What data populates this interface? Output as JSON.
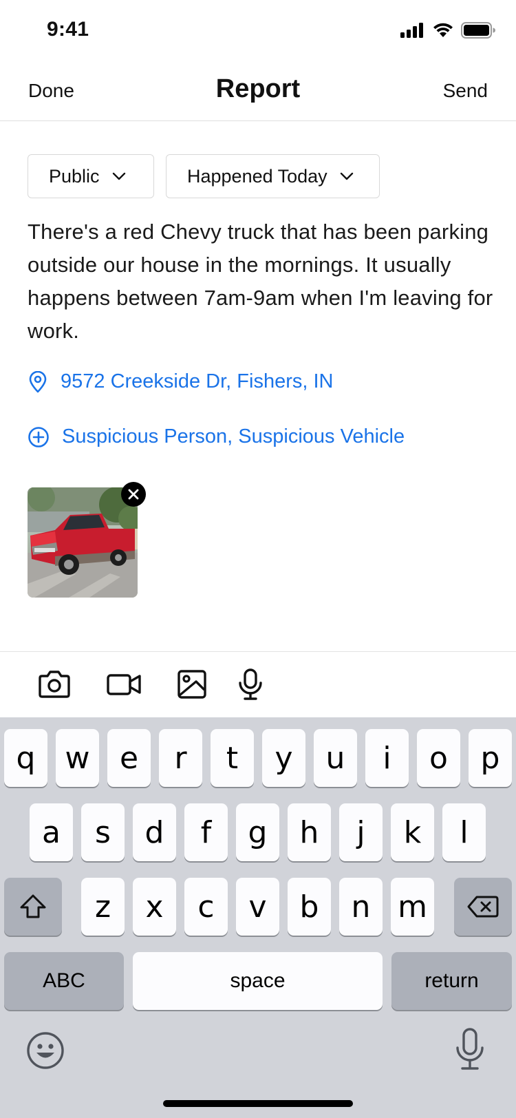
{
  "status_bar": {
    "time": "9:41"
  },
  "nav": {
    "left": "Done",
    "title": "Report",
    "right": "Send"
  },
  "filters": {
    "visibility": "Public",
    "timeframe": "Happened Today"
  },
  "report": {
    "text": "There's a red Chevy truck that has been parking outside our house in the mornings. It usually happens between 7am-9am when I'm leaving for work.",
    "location": "9572 Creekside Dr, Fishers, IN",
    "tags": "Suspicious Person, Suspicious Vehicle"
  },
  "attachment": {
    "icon": "photo-thumbnail"
  },
  "toolbar": {
    "icons": [
      "camera-icon",
      "video-icon",
      "image-icon",
      "microphone-icon"
    ]
  },
  "colors": {
    "link": "#1a73e8",
    "keyboard_bg": "#d1d3d9",
    "key_dark": "#acb0b9"
  },
  "keyboard": {
    "row1": [
      "q",
      "w",
      "e",
      "r",
      "t",
      "y",
      "u",
      "i",
      "o",
      "p"
    ],
    "row2": [
      "a",
      "s",
      "d",
      "f",
      "g",
      "h",
      "j",
      "k",
      "l"
    ],
    "row3": [
      "z",
      "x",
      "c",
      "v",
      "b",
      "n",
      "m"
    ],
    "abc": "ABC",
    "space": "space",
    "return": "return"
  }
}
